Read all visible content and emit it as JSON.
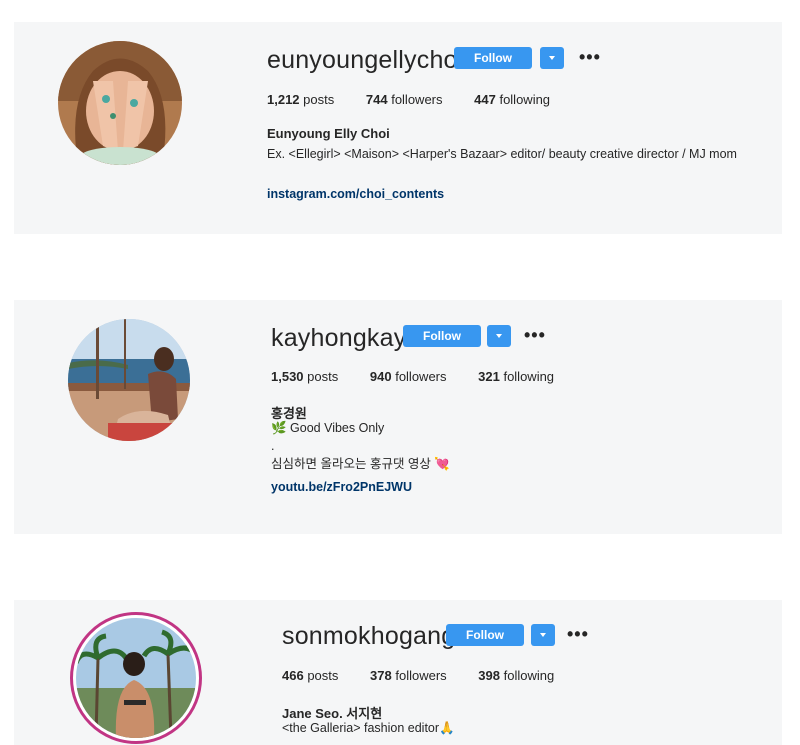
{
  "profiles": [
    {
      "username": "eunyoungellychoi",
      "follow_label": "Follow",
      "more_label": "•••",
      "posts_count": "1,212",
      "posts_label": "posts",
      "followers_count": "744",
      "followers_label": "followers",
      "following_count": "447",
      "following_label": "following",
      "full_name": "Eunyoung Elly Choi",
      "bio": "Ex. <Ellegirl> <Maison> <Harper's Bazaar> editor/ beauty creative director / MJ mom",
      "link": "instagram.com/choi_contents"
    },
    {
      "username": "kayhongkay",
      "follow_label": "Follow",
      "more_label": "•••",
      "posts_count": "1,530",
      "posts_label": "posts",
      "followers_count": "940",
      "followers_label": "followers",
      "following_count": "321",
      "following_label": "following",
      "full_name": "홍경원",
      "bio_line1": "🌿 Good Vibes Only",
      "bio_line2": ".",
      "bio_line3": "심심하면 올라오는 홍규댓 영상 💘",
      "link": "youtu.be/zFro2PnEJWU"
    },
    {
      "username": "sonmokhogang",
      "follow_label": "Follow",
      "more_label": "•••",
      "posts_count": "466",
      "posts_label": "posts",
      "followers_count": "378",
      "followers_label": "followers",
      "following_count": "398",
      "following_label": "following",
      "full_name": "Jane Seo. 서지현",
      "bio": "<the Galleria> fashion editor🙏"
    }
  ],
  "colors": {
    "follow_button": "#3897f0",
    "card_background": "#f5f6f7",
    "link": "#003569",
    "story_ring": "#c13584"
  }
}
